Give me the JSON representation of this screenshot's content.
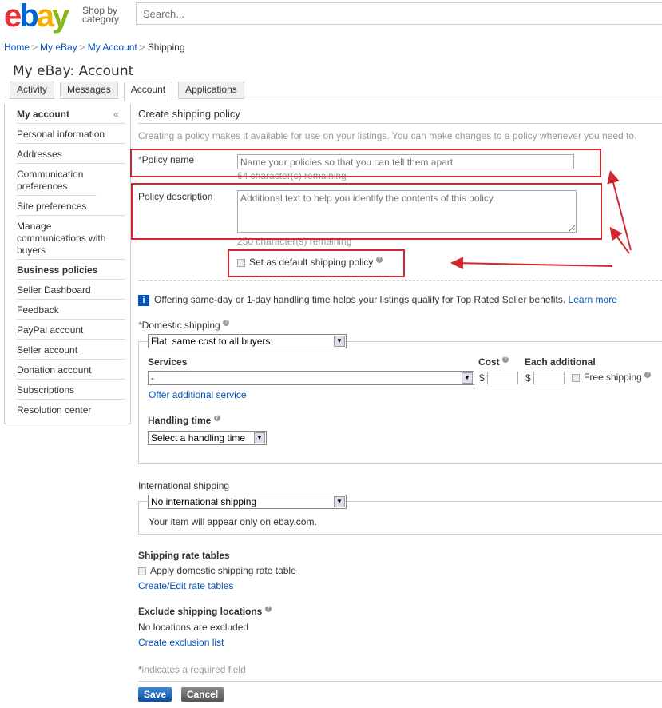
{
  "header": {
    "logo": "ebay",
    "shop_by": "Shop by",
    "category": "category",
    "search_placeholder": "Search..."
  },
  "breadcrumb": [
    "Home",
    "My eBay",
    "My Account",
    "Shipping"
  ],
  "page_title": "My eBay: Account",
  "tabs": [
    "Activity",
    "Messages",
    "Account",
    "Applications"
  ],
  "sidebar": {
    "collapse": "«",
    "items": [
      "My account",
      "Personal information",
      "Addresses",
      "Communication preferences",
      "Site preferences",
      "Manage communications with buyers",
      "Business policies",
      "Seller Dashboard",
      "Feedback",
      "PayPal account",
      "Seller account",
      "Donation account",
      "Subscriptions",
      "Resolution center"
    ]
  },
  "form": {
    "heading": "Create shipping policy",
    "intro": "Creating a policy makes it available for use on your listings. You can make changes to a policy whenever you need to.",
    "policy_name_label": "Policy name",
    "policy_name_placeholder": "Name your policies so that you can tell them apart",
    "policy_name_remaining": "64 character(s) remaining",
    "policy_desc_label": "Policy description",
    "policy_desc_placeholder": "Additional text to help you identify the contents of this policy.",
    "policy_desc_remaining": "250 character(s) remaining",
    "default_label": "Set as default shipping policy",
    "info_text": "Offering same-day or 1-day handling time helps your listings qualify for Top Rated Seller benefits.",
    "learn_more": "Learn more",
    "domestic_label": "Domestic shipping",
    "domestic_value": "Flat: same cost to all buyers",
    "services_label": "Services",
    "services_value": "-",
    "cost_label": "Cost",
    "each_label": "Each additional",
    "currency": "$",
    "free_shipping": "Free shipping",
    "offer_additional": "Offer additional service",
    "handling_label": "Handling time",
    "handling_value": "Select a handling time",
    "intl_label": "International shipping",
    "intl_value": "No international shipping",
    "intl_note": "Your item will appear only on ebay.com.",
    "rate_label": "Shipping rate tables",
    "rate_checkbox": "Apply domestic shipping rate table",
    "rate_link": "Create/Edit rate tables",
    "exclude_label": "Exclude shipping locations",
    "exclude_note": "No locations are excluded",
    "exclude_link": "Create exclusion list",
    "required_note": "indicates a required field",
    "required_star": "*",
    "save": "Save",
    "cancel": "Cancel"
  },
  "colors": {
    "annotation": "#d0282e",
    "save": "#1a5fb4",
    "cancel": "#666666"
  }
}
